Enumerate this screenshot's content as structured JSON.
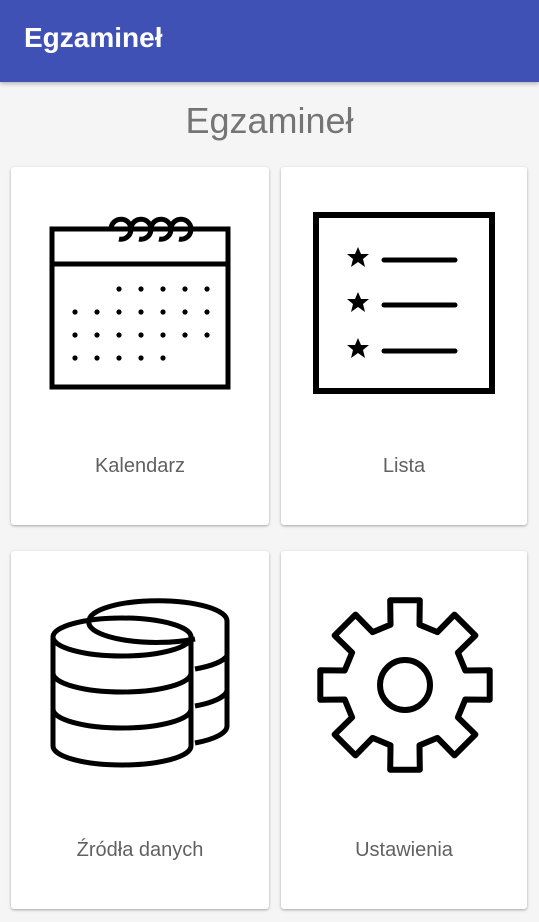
{
  "appbar": {
    "title": "Egzamineł"
  },
  "page": {
    "title": "Egzamineł"
  },
  "tiles": [
    {
      "label": "Kalendarz",
      "icon": "calendar-icon"
    },
    {
      "label": "Lista",
      "icon": "list-icon"
    },
    {
      "label": "Źródła danych",
      "icon": "database-icon"
    },
    {
      "label": "Ustawienia",
      "icon": "gear-icon"
    }
  ],
  "colors": {
    "appbar": "#3f51b5",
    "background": "#f5f5f5",
    "card": "#ffffff"
  }
}
